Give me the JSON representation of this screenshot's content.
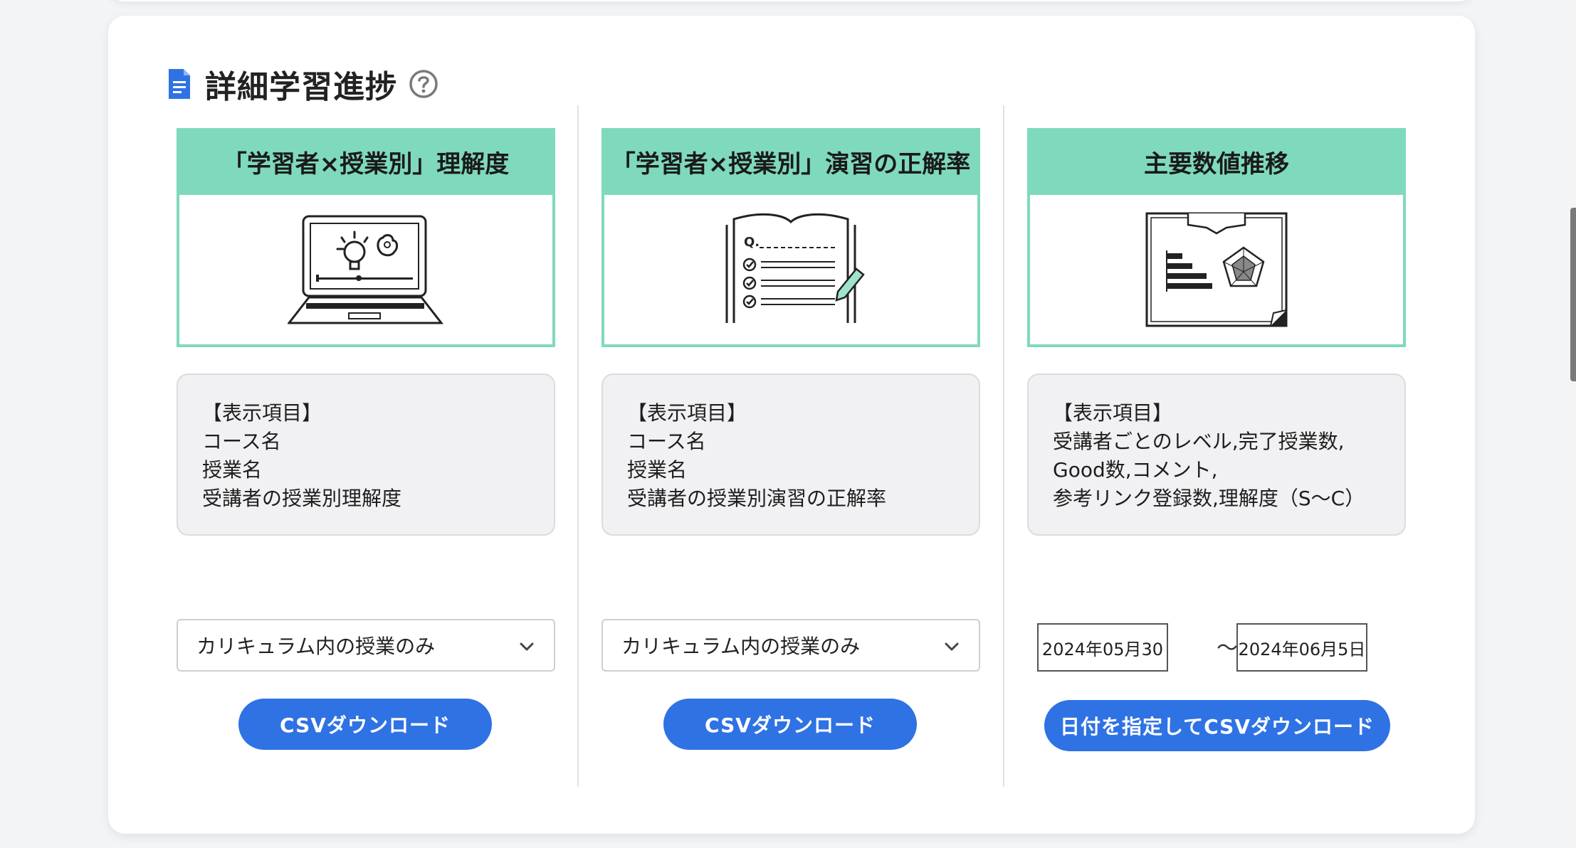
{
  "section": {
    "title": "詳細学習進捗",
    "icon": "document-icon",
    "help_icon": "question-circle-icon"
  },
  "colors": {
    "accent_green": "#7fd9bd",
    "button_blue": "#2f72e4",
    "title_icon_blue": "#2f72e4"
  },
  "cards": [
    {
      "title": "「学習者×授業別」理解度",
      "illustration": "laptop-video-lesson-icon",
      "info_lines": [
        "【表示項目】",
        "コース名",
        "授業名",
        "受講者の授業別理解度"
      ],
      "select_value": "カリキュラム内の授業のみ",
      "button_label": "CSVダウンロード"
    },
    {
      "title": "「学習者×授業別」演習の正解率",
      "illustration": "quiz-checklist-icon",
      "info_lines": [
        "【表示項目】",
        "コース名",
        "授業名",
        "受講者の授業別演習の正解率"
      ],
      "select_value": "カリキュラム内の授業のみ",
      "button_label": "CSVダウンロード"
    },
    {
      "title": "主要数値推移",
      "illustration": "chart-board-icon",
      "info_lines": [
        "【表示項目】",
        "受講者ごとのレベル,完了授業数,",
        "Good数,コメント,",
        "参考リンク登録数,理解度（S〜C）"
      ],
      "date_from": "2024年05月30",
      "date_separator": "〜",
      "date_to": "2024年06月5日",
      "button_label": "日付を指定してCSVダウンロード"
    }
  ]
}
